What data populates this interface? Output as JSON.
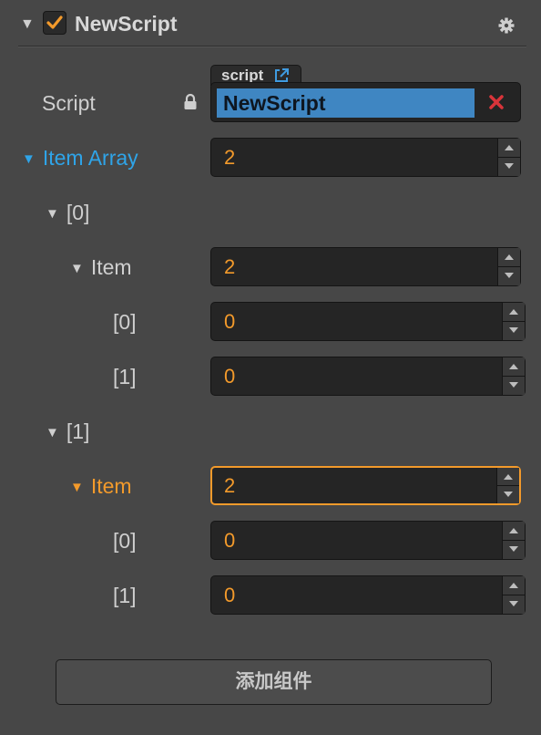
{
  "header": {
    "arrow": "▼",
    "title": "NewScript",
    "enabled": true
  },
  "script_field": {
    "label": "Script",
    "tab_label": "script",
    "value": "NewScript"
  },
  "item_array": {
    "label": "Item Array",
    "value": "2"
  },
  "elements": [
    {
      "label": "[0]",
      "item_label": "Item",
      "item_value": "2",
      "children": [
        {
          "label": "[0]",
          "value": "0"
        },
        {
          "label": "[1]",
          "value": "0"
        }
      ]
    },
    {
      "label": "[1]",
      "item_label": "Item",
      "item_value": "2",
      "children": [
        {
          "label": "[0]",
          "value": "0"
        },
        {
          "label": "[1]",
          "value": "0"
        }
      ]
    }
  ],
  "add_component_label": "添加组件",
  "colors": {
    "accent_blue": "#2fa4e8",
    "accent_orange": "#f39a2b",
    "script_bg": "#3f86c2",
    "remove_red": "#d9343a"
  }
}
